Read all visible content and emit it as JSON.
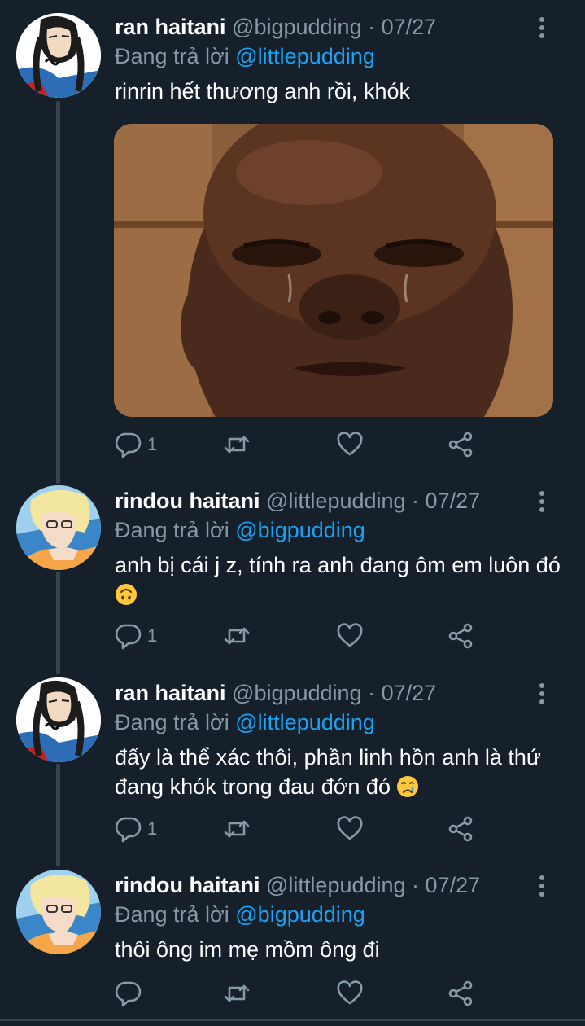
{
  "theme": {
    "background": "#15202b",
    "text": "#ffffff",
    "muted": "#8899a6",
    "link": "#1da1f2",
    "thread_line": "#38444d"
  },
  "icons": {
    "reply": "reply-icon",
    "retweet": "retweet-icon",
    "like": "heart-icon",
    "share": "share-icon",
    "more": "more-vertical-icon"
  },
  "tweets": [
    {
      "name": "ran haitani",
      "handle": "@bigpudding",
      "separator": " · ",
      "date": "07/27",
      "replying_prefix": "Đang trả lời ",
      "replying_to": "@littlepudding",
      "text": "rinrin hết thương anh rồi, khók",
      "media": "crying-man-photo",
      "reply_count": "1"
    },
    {
      "name": "rindou haitani",
      "handle": "@littlepudding",
      "separator": " · ",
      "date": "07/27",
      "replying_prefix": "Đang trả lời ",
      "replying_to": "@bigpudding",
      "text": "anh bị cái j z, tính ra anh đang ôm em luôn đó",
      "emoji": "upside-down-face",
      "reply_count": "1"
    },
    {
      "name": "ran haitani",
      "handle": "@bigpudding",
      "separator": " · ",
      "date": "07/27",
      "replying_prefix": "Đang trả lời ",
      "replying_to": "@littlepudding",
      "text": "đấy là thể xác thôi, phần linh hồn anh là thứ đang khók trong đau đớn đó",
      "emoji": "crying-face",
      "reply_count": "1"
    },
    {
      "name": "rindou haitani",
      "handle": "@littlepudding",
      "separator": " · ",
      "date": "07/27",
      "replying_prefix": "Đang trả lời ",
      "replying_to": "@bigpudding",
      "text": "thôi ông im mẹ mồm ông đi",
      "reply_count": ""
    }
  ]
}
